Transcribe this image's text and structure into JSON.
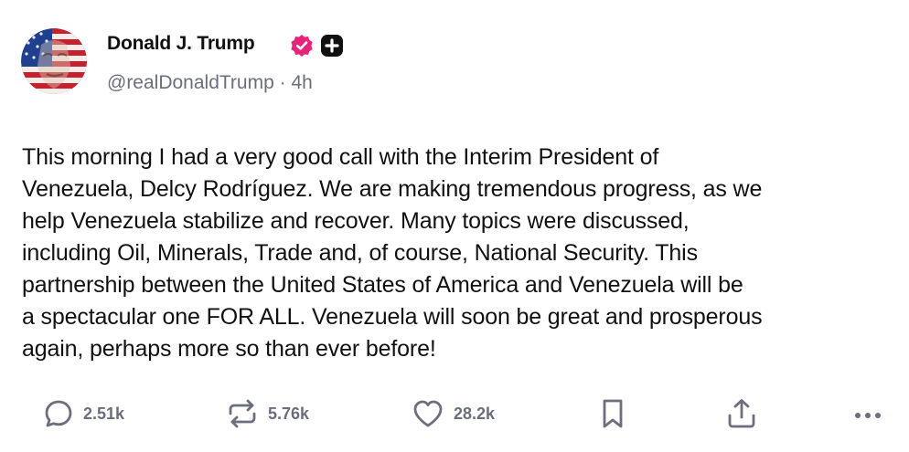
{
  "post": {
    "author": {
      "display_name": "Donald J. Trump",
      "handle": "@realDonaldTrump",
      "separator": "·",
      "time_ago": "4h"
    },
    "text_lines": [
      "This morning I had a very good call with the Interim President of",
      "Venezuela, Delcy Rodríguez. We are making tremendous progress, as we",
      "help Venezuela stabilize and recover. Many topics were discussed,",
      "including Oil, Minerals, Trade and, of course, National Security. This",
      "partnership between the United States of America and Venezuela will be",
      "a spectacular one FOR ALL. Venezuela will soon be great and prosperous",
      "again, perhaps more so than ever before!"
    ],
    "actions": {
      "replies": "2.51k",
      "reposts": "5.76k",
      "likes": "28.2k"
    }
  },
  "icons": {
    "verified": "verified-badge-icon",
    "plus": "plus-badge-icon",
    "reply": "speech-bubble-icon",
    "repost": "repost-arrows-icon",
    "like": "heart-icon",
    "bookmark": "bookmark-icon",
    "share": "share-upload-icon",
    "more": "ellipsis-icon"
  },
  "colors": {
    "text": "#111114",
    "muted": "#6b6f7d",
    "verified": "#e6247a",
    "icon": "#6b6f7d"
  }
}
